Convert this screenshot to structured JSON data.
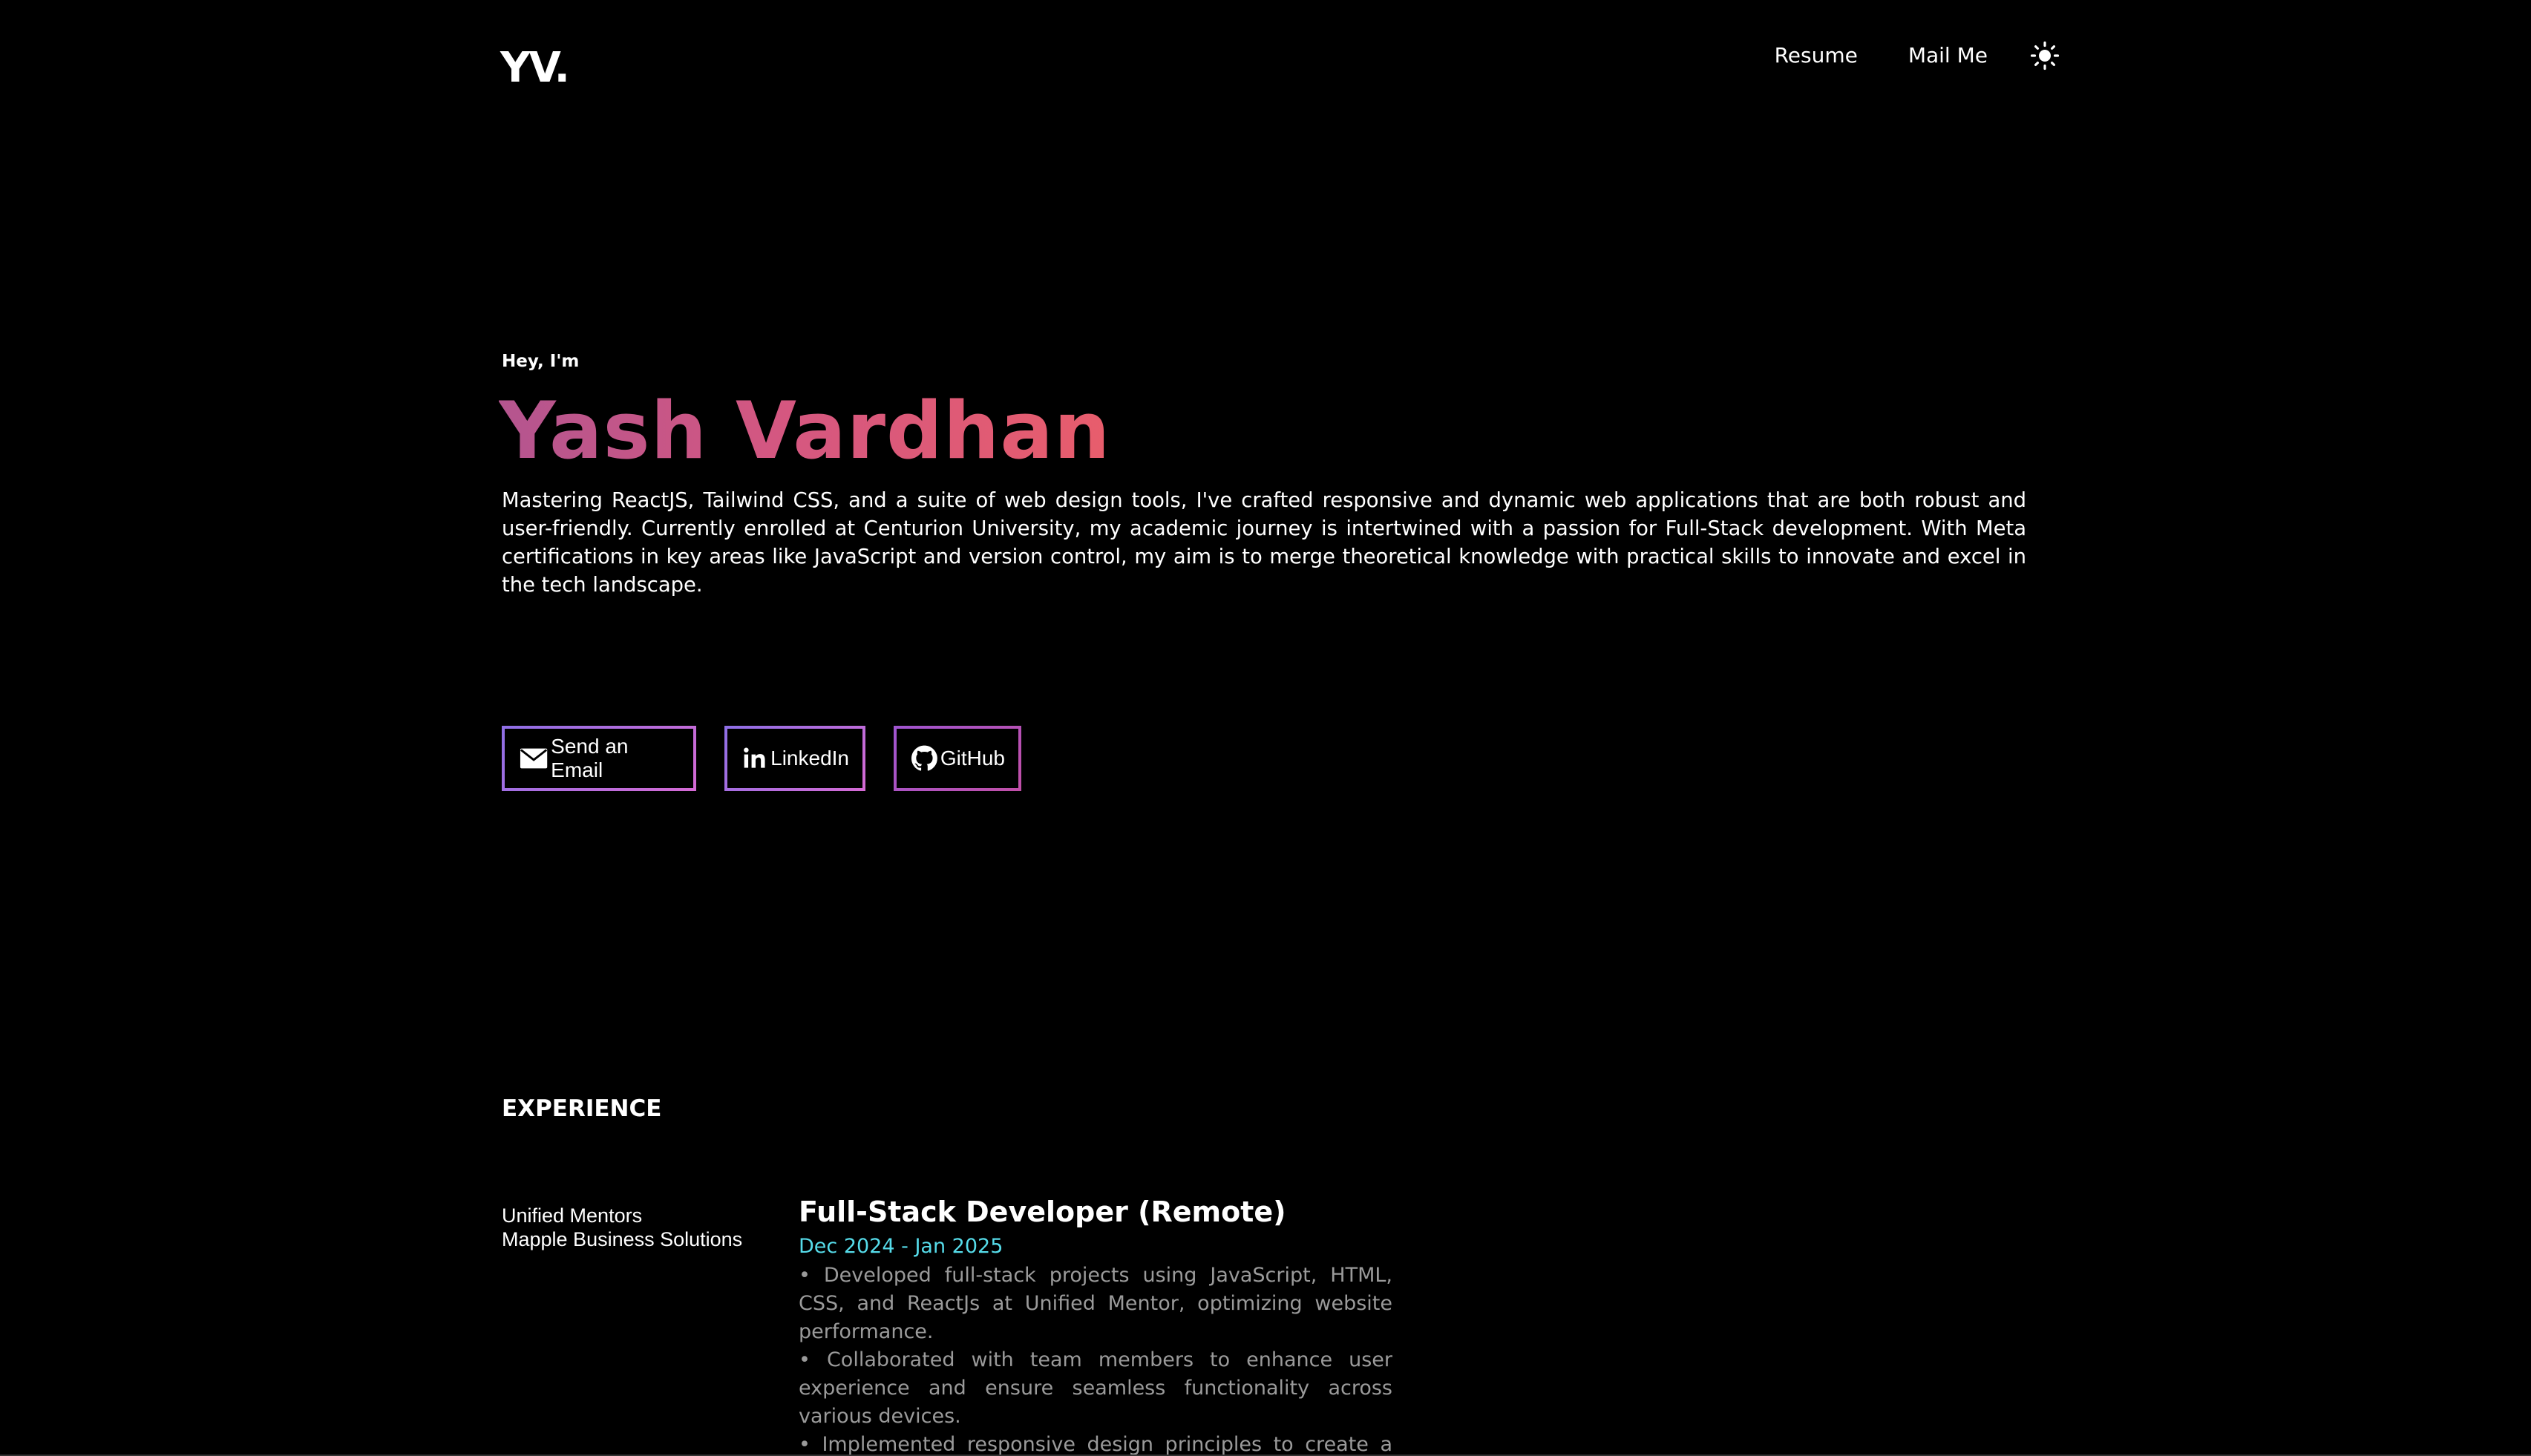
{
  "header": {
    "logo": "YV.",
    "nav": [
      "Resume",
      "Mail Me"
    ],
    "theme_icon": "sun-icon"
  },
  "hero": {
    "greeting": "Hey, I'm",
    "name": "Yash Vardhan",
    "bio": "Mastering ReactJS, Tailwind CSS, and a suite of web design tools, I've crafted responsive and dynamic web applications that are both robust and user-friendly. Currently enrolled at Centurion University, my academic journey is intertwined with a passion for Full-Stack development. With Meta certifications in key areas like JavaScript and version control, my aim is to merge theoretical knowledge with practical skills to innovate and excel in the tech landscape.",
    "name_gradient": [
      "#b4558f",
      "#e85d6c"
    ]
  },
  "buttons": [
    {
      "label": "Send an Email",
      "icon": "mail-icon"
    },
    {
      "label": "LinkedIn",
      "icon": "linkedin-icon"
    },
    {
      "label": "GitHub",
      "icon": "github-icon"
    }
  ],
  "experience": {
    "heading": "EXPERIENCE",
    "companies": [
      "Unified Mentors",
      "Mapple Business Solutions"
    ],
    "role": {
      "title": "Full-Stack Developer (Remote)",
      "dates": "Dec 2024 - Jan 2025",
      "bullets": [
        "• Developed full-stack projects using JavaScript, HTML, CSS, and ReactJs at Unified Mentor, optimizing website performance.",
        "• Collaborated with team members to enhance user experience and ensure seamless functionality across various devices.",
        "• Implemented responsive design principles to create a user-friendly interface for improved user engagement."
      ]
    }
  },
  "colors": {
    "background": "#000000",
    "accent_dates": "#56dcea",
    "muted_text": "#9a9a9a",
    "button_border": "#8f6fe6"
  }
}
